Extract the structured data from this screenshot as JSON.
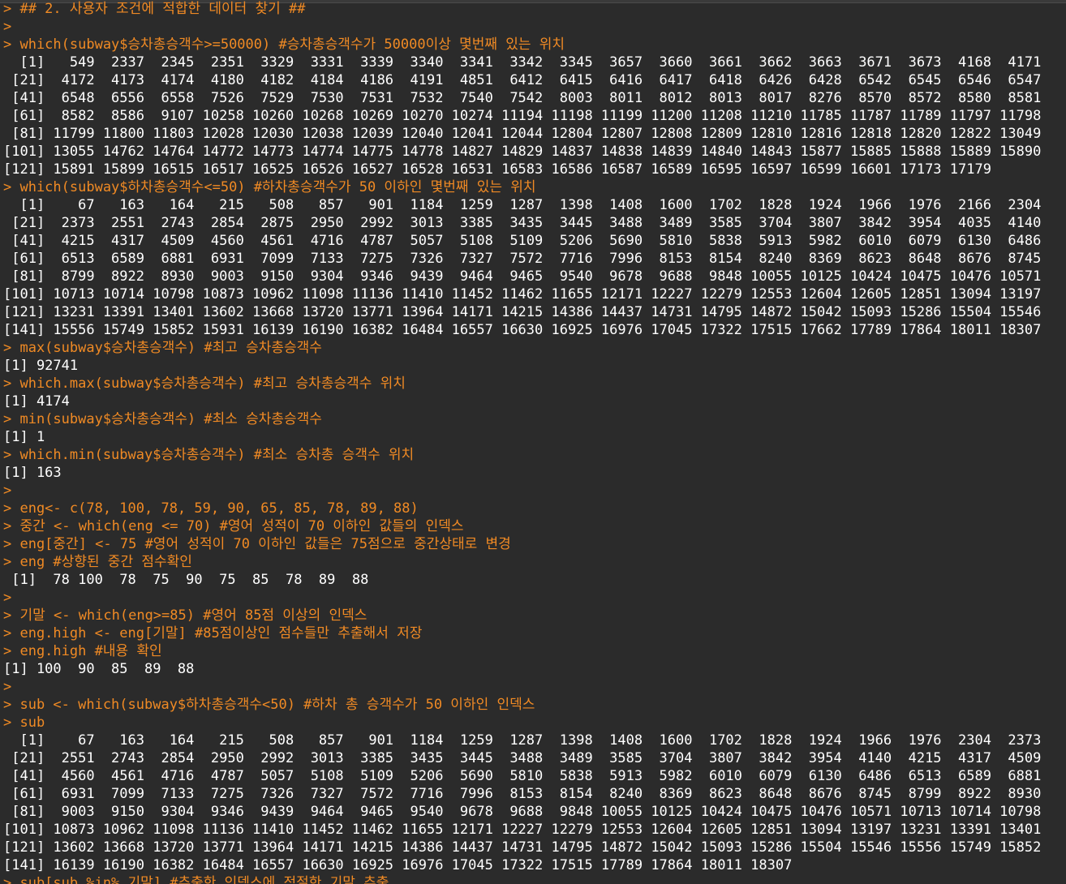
{
  "colors": {
    "background": "#2b2b2b",
    "input_text": "#f08a24",
    "output_text": "#ffffff"
  },
  "console_lines": [
    {
      "type": "in",
      "text": "> ## 2. 사용자 조건에 적합한 데이터 찾기 ##"
    },
    {
      "type": "in",
      "text": ">"
    },
    {
      "type": "in",
      "text": "> which(subway$승차총승객수>=50000) #승차총승객수가 50000이상 몇번째 있는 위치"
    },
    {
      "type": "out",
      "text": "  [1]   549  2337  2345  2351  3329  3331  3339  3340  3341  3342  3345  3657  3660  3661  3662  3663  3671  3673  4168  4171"
    },
    {
      "type": "out",
      "text": " [21]  4172  4173  4174  4180  4182  4184  4186  4191  4851  6412  6415  6416  6417  6418  6426  6428  6542  6545  6546  6547"
    },
    {
      "type": "out",
      "text": " [41]  6548  6556  6558  7526  7529  7530  7531  7532  7540  7542  8003  8011  8012  8013  8017  8276  8570  8572  8580  8581"
    },
    {
      "type": "out",
      "text": " [61]  8582  8586  9107 10258 10260 10268 10269 10270 10274 11194 11198 11199 11200 11208 11210 11785 11787 11789 11797 11798"
    },
    {
      "type": "out",
      "text": " [81] 11799 11800 11803 12028 12030 12038 12039 12040 12041 12044 12804 12807 12808 12809 12810 12816 12818 12820 12822 13049"
    },
    {
      "type": "out",
      "text": "[101] 13055 14762 14764 14772 14773 14774 14775 14778 14827 14829 14837 14838 14839 14840 14843 15877 15885 15888 15889 15890"
    },
    {
      "type": "out",
      "text": "[121] 15891 15899 16515 16517 16525 16526 16527 16528 16531 16583 16586 16587 16589 16595 16597 16599 16601 17173 17179"
    },
    {
      "type": "in",
      "text": "> which(subway$하차총승객수<=50) #하차총승객수가 50 이하인 몇번째 있는 위치"
    },
    {
      "type": "out",
      "text": "  [1]    67   163   164   215   508   857   901  1184  1259  1287  1398  1408  1600  1702  1828  1924  1966  1976  2166  2304"
    },
    {
      "type": "out",
      "text": " [21]  2373  2551  2743  2854  2875  2950  2992  3013  3385  3435  3445  3488  3489  3585  3704  3807  3842  3954  4035  4140"
    },
    {
      "type": "out",
      "text": " [41]  4215  4317  4509  4560  4561  4716  4787  5057  5108  5109  5206  5690  5810  5838  5913  5982  6010  6079  6130  6486"
    },
    {
      "type": "out",
      "text": " [61]  6513  6589  6881  6931  7099  7133  7275  7326  7327  7572  7716  7996  8153  8154  8240  8369  8623  8648  8676  8745"
    },
    {
      "type": "out",
      "text": " [81]  8799  8922  8930  9003  9150  9304  9346  9439  9464  9465  9540  9678  9688  9848 10055 10125 10424 10475 10476 10571"
    },
    {
      "type": "out",
      "text": "[101] 10713 10714 10798 10873 10962 11098 11136 11410 11452 11462 11655 12171 12227 12279 12553 12604 12605 12851 13094 13197"
    },
    {
      "type": "out",
      "text": "[121] 13231 13391 13401 13602 13668 13720 13771 13964 14171 14215 14386 14437 14731 14795 14872 15042 15093 15286 15504 15546"
    },
    {
      "type": "out",
      "text": "[141] 15556 15749 15852 15931 16139 16190 16382 16484 16557 16630 16925 16976 17045 17322 17515 17662 17789 17864 18011 18307"
    },
    {
      "type": "in",
      "text": "> max(subway$승차총승객수) #최고 승차총승객수"
    },
    {
      "type": "out",
      "text": "[1] 92741"
    },
    {
      "type": "in",
      "text": "> which.max(subway$승차총승객수) #최고 승차총승객수 위치"
    },
    {
      "type": "out",
      "text": "[1] 4174"
    },
    {
      "type": "in",
      "text": "> min(subway$승차총승객수) #최소 승차총승객수"
    },
    {
      "type": "out",
      "text": "[1] 1"
    },
    {
      "type": "in",
      "text": "> which.min(subway$승차총승객수) #최소 승차총 승객수 위치"
    },
    {
      "type": "out",
      "text": "[1] 163"
    },
    {
      "type": "in",
      "text": ">"
    },
    {
      "type": "in",
      "text": "> eng<- c(78, 100, 78, 59, 90, 65, 85, 78, 89, 88)"
    },
    {
      "type": "in",
      "text": "> 중간 <- which(eng <= 70) #영어 성적이 70 이하인 값들의 인덱스"
    },
    {
      "type": "in",
      "text": "> eng[중간] <- 75 #영어 성적이 70 이하인 값들은 75점으로 중간상태로 변경"
    },
    {
      "type": "in",
      "text": "> eng #상향된 중간 점수확인"
    },
    {
      "type": "out",
      "text": " [1]  78 100  78  75  90  75  85  78  89  88"
    },
    {
      "type": "in",
      "text": ">"
    },
    {
      "type": "in",
      "text": "> 기말 <- which(eng>=85) #영어 85점 이상의 인덱스"
    },
    {
      "type": "in",
      "text": "> eng.high <- eng[기말] #85점이상인 점수들만 추출해서 저장"
    },
    {
      "type": "in",
      "text": "> eng.high #내용 확인"
    },
    {
      "type": "out",
      "text": "[1] 100  90  85  89  88"
    },
    {
      "type": "in",
      "text": ">"
    },
    {
      "type": "in",
      "text": "> sub <- which(subway$하차총승객수<50) #하차 총 승객수가 50 이하인 인덱스"
    },
    {
      "type": "in",
      "text": "> sub"
    },
    {
      "type": "out",
      "text": "  [1]    67   163   164   215   508   857   901  1184  1259  1287  1398  1408  1600  1702  1828  1924  1966  1976  2304  2373"
    },
    {
      "type": "out",
      "text": " [21]  2551  2743  2854  2950  2992  3013  3385  3435  3445  3488  3489  3585  3704  3807  3842  3954  4140  4215  4317  4509"
    },
    {
      "type": "out",
      "text": " [41]  4560  4561  4716  4787  5057  5108  5109  5206  5690  5810  5838  5913  5982  6010  6079  6130  6486  6513  6589  6881"
    },
    {
      "type": "out",
      "text": " [61]  6931  7099  7133  7275  7326  7327  7572  7716  7996  8153  8154  8240  8369  8623  8648  8676  8745  8799  8922  8930"
    },
    {
      "type": "out",
      "text": " [81]  9003  9150  9304  9346  9439  9464  9465  9540  9678  9688  9848 10055 10125 10424 10475 10476 10571 10713 10714 10798"
    },
    {
      "type": "out",
      "text": "[101] 10873 10962 11098 11136 11410 11452 11462 11655 12171 12227 12279 12553 12604 12605 12851 13094 13197 13231 13391 13401"
    },
    {
      "type": "out",
      "text": "[121] 13602 13668 13720 13771 13964 14171 14215 14386 14437 14731 14795 14872 15042 15093 15286 15504 15546 15556 15749 15852"
    },
    {
      "type": "out",
      "text": "[141] 16139 16190 16382 16484 16557 16630 16925 16976 17045 17322 17515 17789 17864 18011 18307"
    },
    {
      "type": "in",
      "text": "> sub[sub %in% 기말] #추출한 인덱스에 적절한 기말 추출"
    }
  ]
}
